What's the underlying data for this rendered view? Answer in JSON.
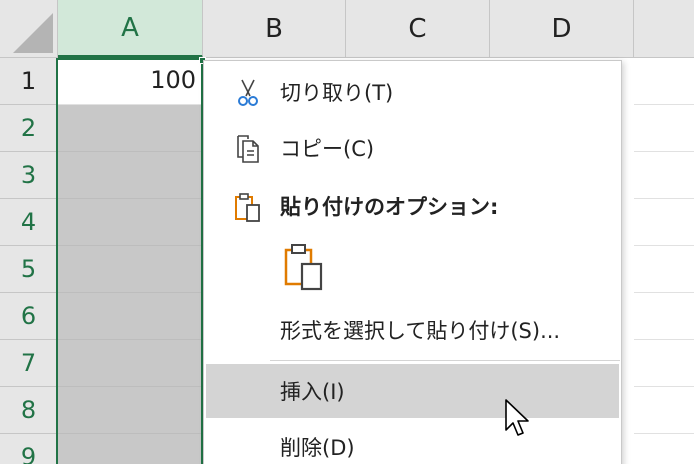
{
  "sheet": {
    "columns": [
      "A",
      "B",
      "C",
      "D"
    ],
    "rows": [
      "1",
      "2",
      "3",
      "4",
      "5",
      "6",
      "7",
      "8",
      "9"
    ],
    "cell_a1": "100"
  },
  "context_menu": {
    "cut": "切り取り(T)",
    "copy": "コピー(C)",
    "paste_options": "貼り付けのオプション:",
    "paste_special": "形式を選択して貼り付け(S)...",
    "insert": "挿入(I)",
    "delete": "削除(D)"
  },
  "colors": {
    "accent": "#217346",
    "selection_fill": "#c8c8c8",
    "menu_hover": "#d4d4d4",
    "paste_icon": "#e07b00",
    "scissors_blue": "#2b7bd6"
  },
  "icons": {
    "cut": "scissors-icon",
    "copy": "copy-icon",
    "paste_options": "paste-icon",
    "paste_option_default": "paste-icon",
    "cursor": "mouse-pointer-icon"
  }
}
